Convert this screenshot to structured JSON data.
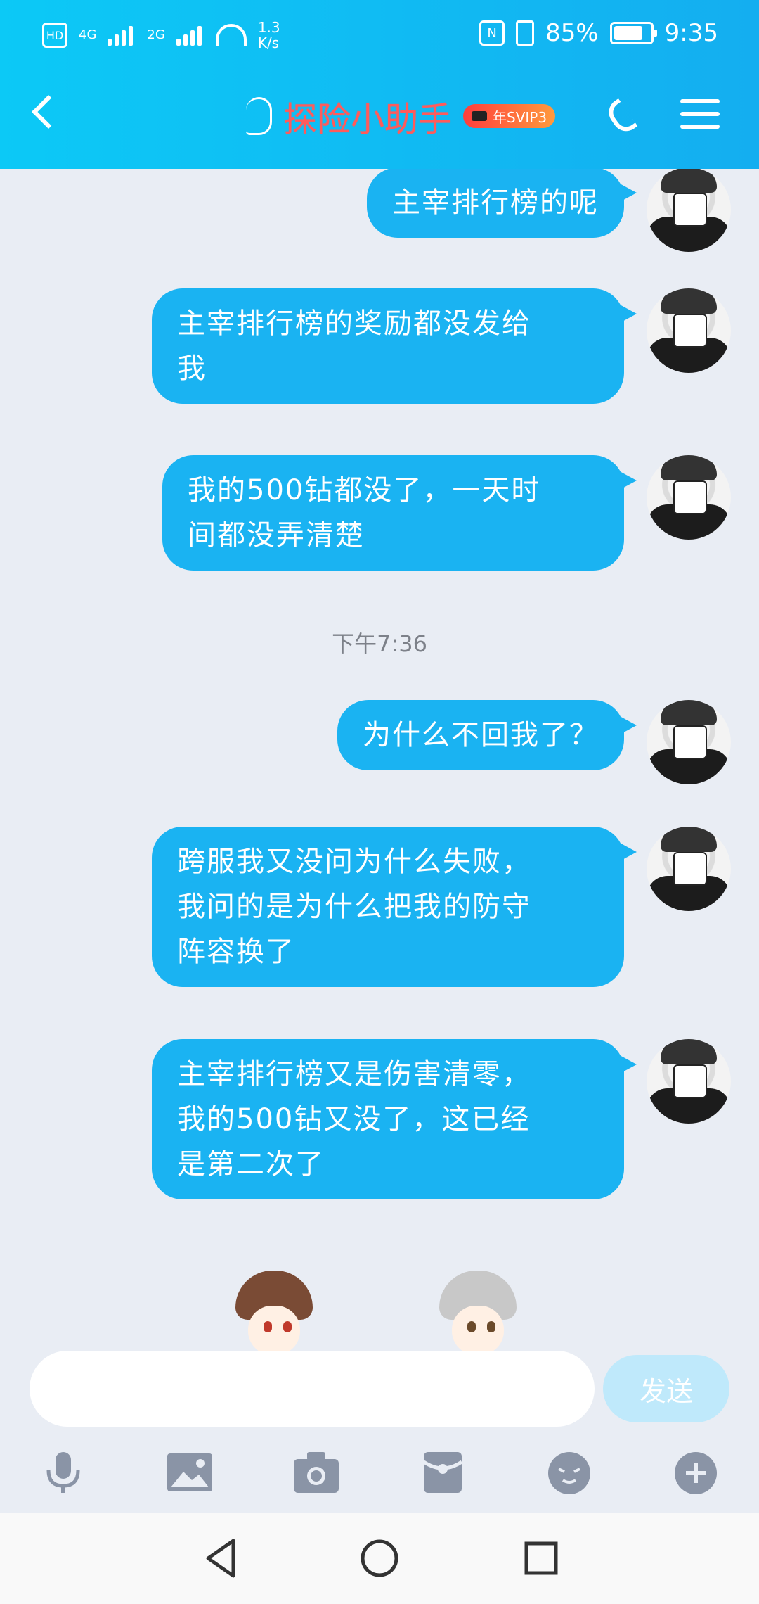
{
  "status_bar": {
    "hd": "HD",
    "net_a": "4G",
    "net_b": "2G",
    "speed_value": "1.3",
    "speed_unit": "K/s",
    "nfc": "N",
    "battery": "85%",
    "time": "9:35"
  },
  "header": {
    "title": "探险小助手",
    "badge": "年SVIP3"
  },
  "messages": [
    {
      "text": "主宰排行榜的呢"
    },
    {
      "text": "主宰排行榜的奖励都没发给\n我"
    },
    {
      "text": "我的500钻都没了，一天时\n间都没弄清楚"
    },
    {
      "text": "为什么不回我了？"
    },
    {
      "text": "跨服我又没问为什么失败，\n我问的是为什么把我的防守\n阵容换了"
    },
    {
      "text": "主宰排行榜又是伤害清零，\n我的500钻又没了，这已经\n是第二次了"
    }
  ],
  "timestamp": "下午7:36",
  "composer": {
    "placeholder": "",
    "send_label": "发送"
  },
  "toolbar": {
    "icons": [
      "microphone-icon",
      "image-icon",
      "camera-icon",
      "red-packet-icon",
      "emoji-icon",
      "plus-icon"
    ]
  },
  "colors": {
    "header_start": "#0cc9f6",
    "header_end": "#14aef0",
    "bubble": "#1ab3f2",
    "title": "#ff5b5b",
    "send_disabled": "#bfe9fb",
    "background": "#e9edf4"
  }
}
